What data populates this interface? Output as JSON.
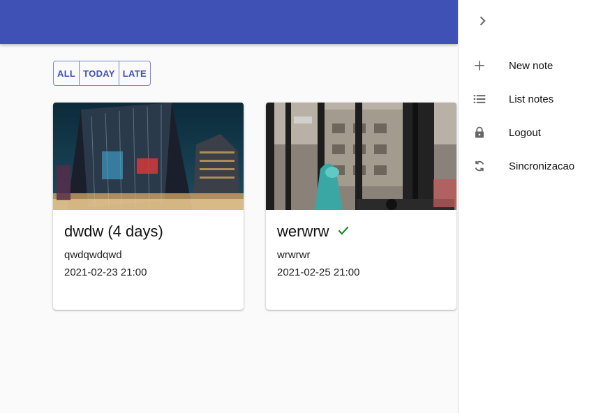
{
  "filters": [
    "ALL",
    "TODAY",
    "LATE"
  ],
  "notes": [
    {
      "title": "dwdw (4 days)",
      "description": "qwdqwdqwd",
      "date": "2021-02-23 21:00",
      "done": false
    },
    {
      "title": "werwrw",
      "description": "wrwrwr",
      "date": "2021-02-25 21:00",
      "done": true
    }
  ],
  "drawer": {
    "toggle_icon": "chevron-right-icon",
    "items": [
      {
        "label": "New note",
        "icon": "plus-icon"
      },
      {
        "label": "List notes",
        "icon": "list-icon"
      },
      {
        "label": "Logout",
        "icon": "lock-icon"
      },
      {
        "label": "Sincronizacao",
        "icon": "sync-icon"
      }
    ]
  },
  "colors": {
    "appbar": "#3f51b5",
    "accent_text": "#3f51b5",
    "check": "#1b8a2b"
  }
}
